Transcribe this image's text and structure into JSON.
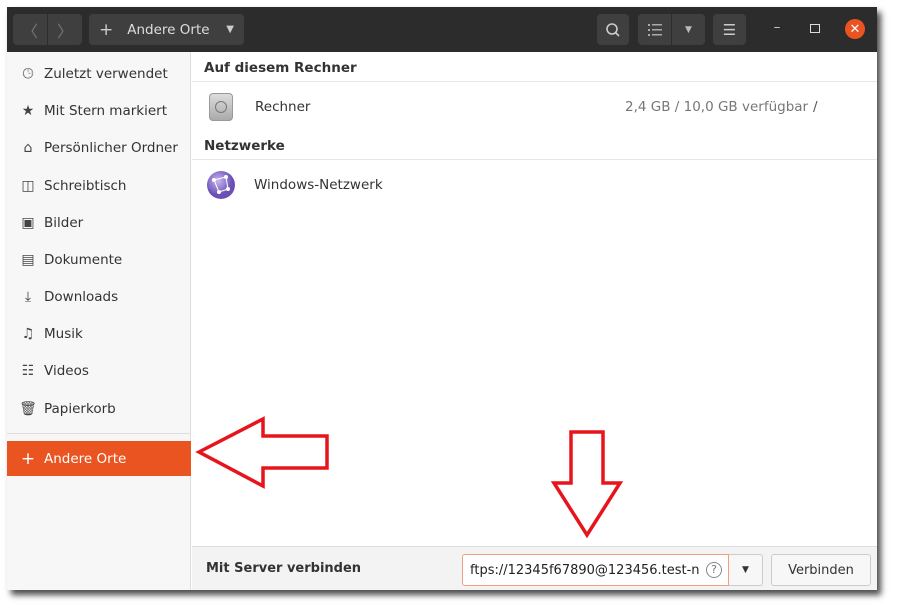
{
  "header": {
    "location": "Andere Orte",
    "icons": [
      "back-icon",
      "forward-icon",
      "plus-icon",
      "dropdown-icon",
      "search-icon",
      "list-view-icon",
      "view-options-icon",
      "menu-icon",
      "minimize-icon",
      "maximize-icon",
      "close-icon"
    ]
  },
  "sidebar": {
    "items": [
      {
        "label": "Zuletzt verwendet",
        "icon": "clock-icon"
      },
      {
        "label": "Mit Stern markiert",
        "icon": "star-icon"
      },
      {
        "label": "Persönlicher Ordner",
        "icon": "home-icon"
      },
      {
        "label": "Schreibtisch",
        "icon": "desktop-icon"
      },
      {
        "label": "Bilder",
        "icon": "image-icon"
      },
      {
        "label": "Dokumente",
        "icon": "document-icon"
      },
      {
        "label": "Downloads",
        "icon": "download-icon"
      },
      {
        "label": "Musik",
        "icon": "music-icon"
      },
      {
        "label": "Videos",
        "icon": "video-icon"
      },
      {
        "label": "Papierkorb",
        "icon": "trash-icon"
      }
    ],
    "other": {
      "label": "Andere Orte",
      "icon": "plus-icon"
    }
  },
  "main": {
    "section1": "Auf diesem Rechner",
    "computer": {
      "name": "Rechner",
      "space": "2,4 GB / 10,0 GB verfügbar",
      "mount": "/"
    },
    "section2": "Netzwerke",
    "network": {
      "name": "Windows-Netzwerk"
    }
  },
  "bottom": {
    "label": "Mit Server verbinden",
    "server_value": "ftps://12345f67890@123456.test-n",
    "connect": "Verbinden"
  },
  "colors": {
    "accent": "#e95420",
    "annotation": "#e8141c"
  }
}
